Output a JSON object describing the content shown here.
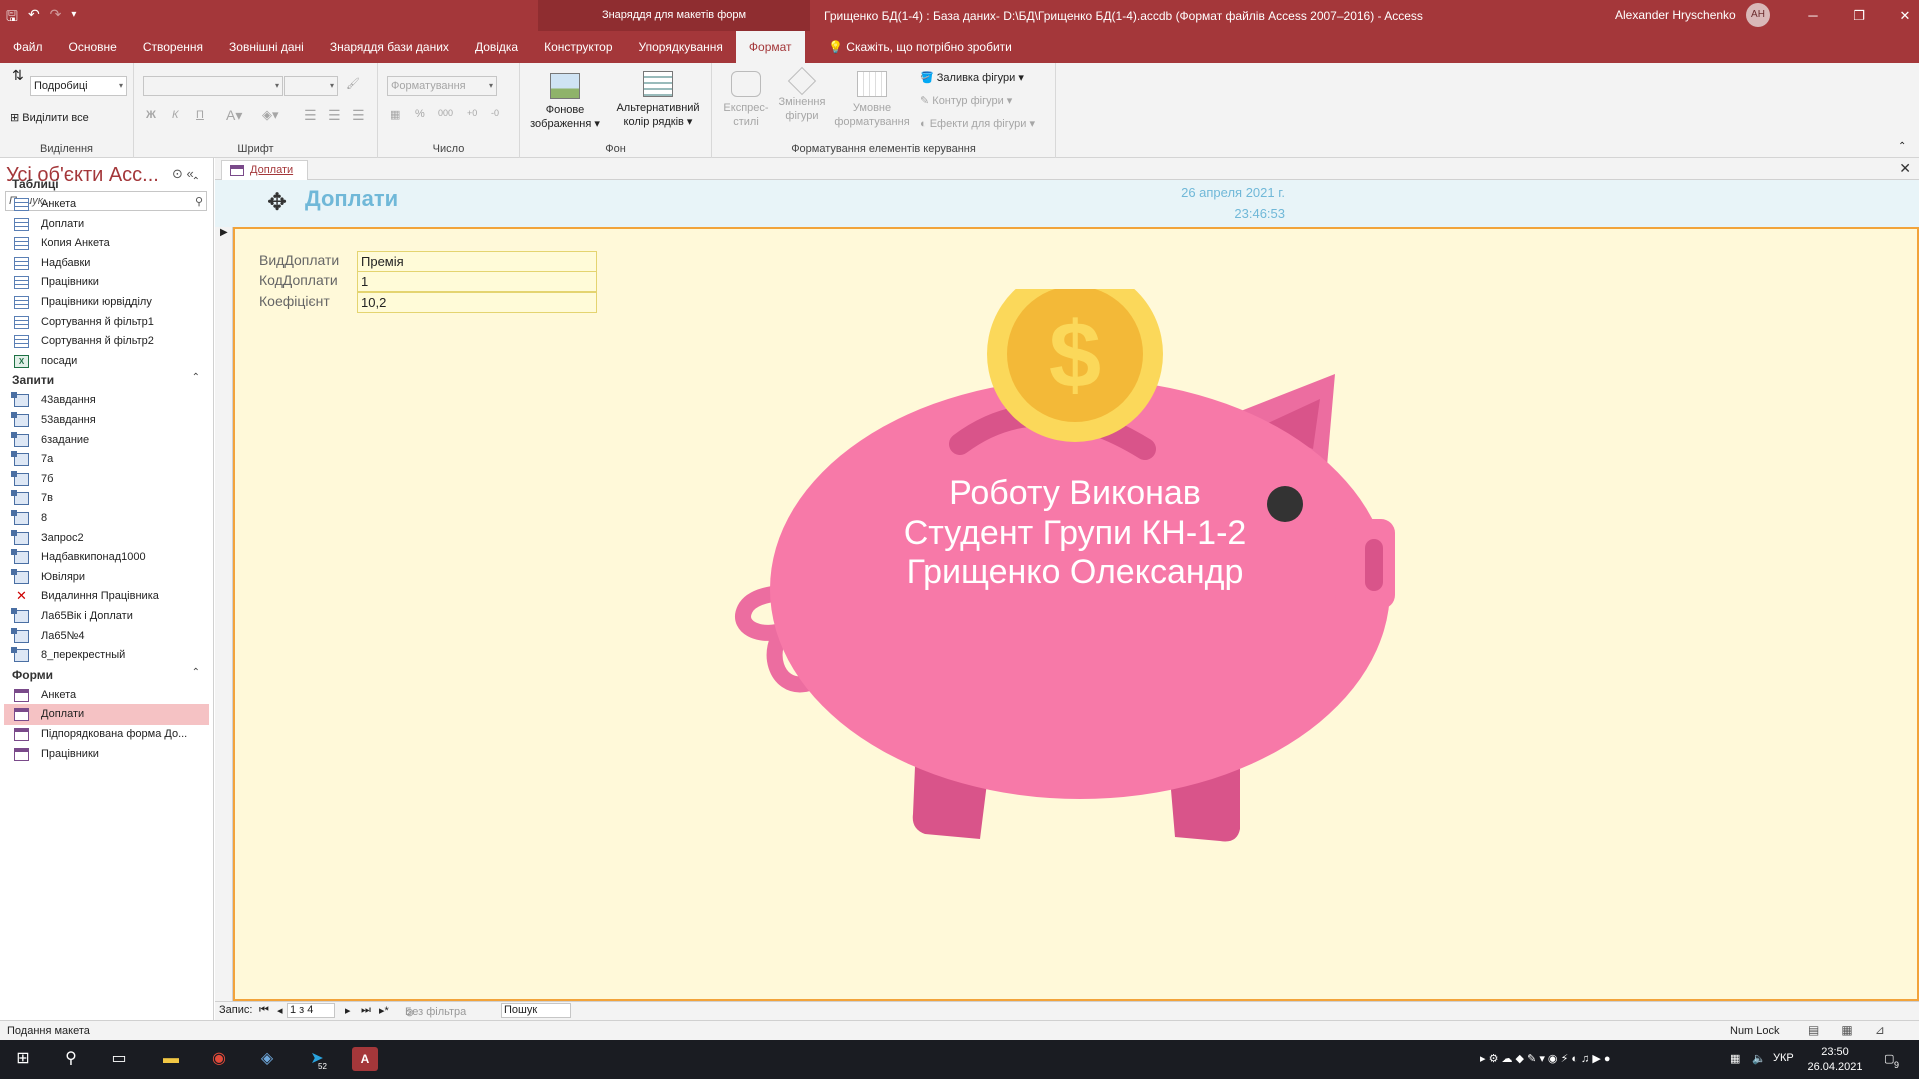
{
  "window": {
    "context_header": "Знаряддя для макетів форм",
    "title": "Грищенко БД(1-4) : База даних- D:\\БД\\Грищенко БД(1-4).accdb (Формат файлів Access 2007–2016)  -  Access",
    "user": "Alexander Hryschenko",
    "avatar": "AH"
  },
  "tabs": [
    "Файл",
    "Основне",
    "Створення",
    "Зовнішні дані",
    "Знаряддя бази даних",
    "Довідка",
    "Конструктор",
    "Упорядкування",
    "Формат"
  ],
  "active_tab": "Формат",
  "tell_me": "Скажіть, що потрібно зробити",
  "ribbon": {
    "selection": {
      "dropdown": "Подробиці",
      "select_all": "Виділити все",
      "label": "Виділення"
    },
    "font": {
      "bold": "Ж",
      "italic": "К",
      "underline": "П",
      "label": "Шрифт"
    },
    "number": {
      "format": "Форматування",
      "label": "Число"
    },
    "background": {
      "bg_image": "Фонове зображення",
      "alt_color": "Альтернативний колір рядків",
      "label": "Фон"
    },
    "control_format": {
      "quick_styles": "Експрес-стилі",
      "change_shape": "Змінення фігури",
      "conditional": "Умовне форматування",
      "fill": "Заливка фігури",
      "outline": "Контур фігури",
      "effects": "Ефекти для фігури",
      "label": "Форматування елементів керування"
    }
  },
  "nav": {
    "header": "Усі об'єкти Acc...",
    "search_placeholder": "Пошук...",
    "sections": [
      {
        "name": "Таблиці",
        "items": [
          "Анкета",
          "Доплати",
          "Копия Анкета",
          "Надбавки",
          "Працівники",
          "Працівники юрвідділу",
          "Сортування й фільтр1",
          "Сортування й фільтр2",
          "посади"
        ]
      },
      {
        "name": "Запити",
        "items": [
          "43авдання",
          "53авдання",
          "6задание",
          "7а",
          "7б",
          "7в",
          "8",
          "Запрос2",
          "Надбавкипонад1000",
          "Ювіляри",
          "Видалиння Працівника",
          "Ла65Вік і Доплати",
          "Ла65№4",
          "8_перекрестный"
        ]
      },
      {
        "name": "Форми",
        "items": [
          "Анкета",
          "Доплати",
          "Підпорядкована форма До...",
          "Працівники"
        ]
      }
    ],
    "selected": "Доплати"
  },
  "document": {
    "tab": "Доплати",
    "form_title": "Доплати",
    "date": "26 апреля 2021 г.",
    "time": "23:46:53",
    "fields": [
      {
        "label": "ВидДоплати",
        "value": "Премія"
      },
      {
        "label": "КодДоплати",
        "value": "1"
      },
      {
        "label": "Коефіцієнт",
        "value": "10,2"
      }
    ],
    "caption": [
      "Роботу Виконав",
      "Студент Групи КН-1-2",
      "Грищенко Олександр"
    ],
    "coin_symbol": "$"
  },
  "record_nav": {
    "label": "Запис:",
    "position": "1 з 4",
    "filter": "Без фільтра",
    "search": "Пошук"
  },
  "status": {
    "text": "Подання макета",
    "numlock": "Num Lock"
  },
  "taskbar": {
    "lang": "УКР",
    "time": "23:50",
    "date": "26.04.2021",
    "notif_count": "9",
    "telegram_badge": "52"
  }
}
